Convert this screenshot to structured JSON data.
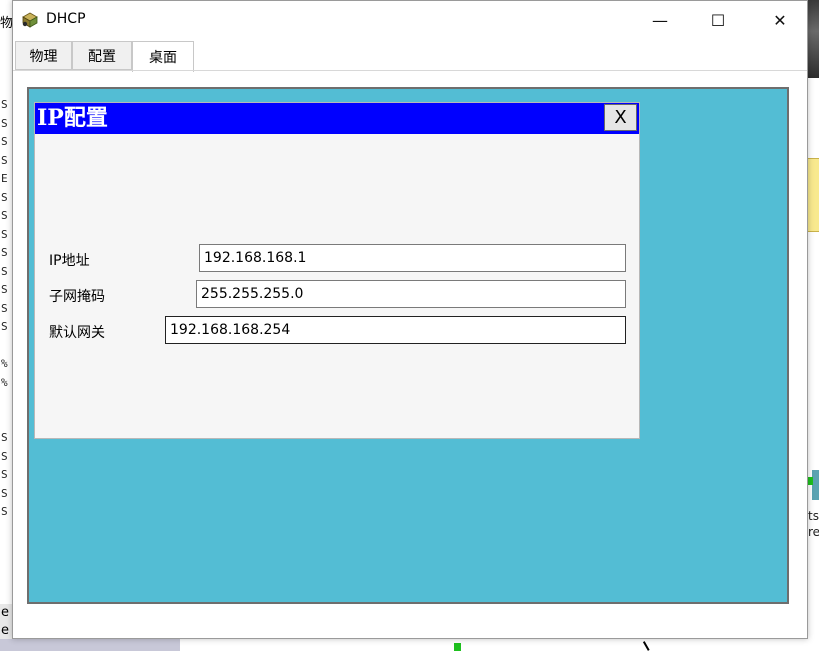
{
  "background": {
    "left_top_char": "物",
    "left_column_letters": [
      "S",
      "S",
      "S",
      "S",
      "E",
      "S",
      "S",
      "S",
      "S",
      "S",
      "S",
      "S",
      "S",
      "",
      "%",
      "%",
      "",
      "",
      "S",
      "S",
      "S",
      "S",
      "S"
    ],
    "bottom_left_letters": [
      "e",
      "e"
    ],
    "right_text": [
      "ts",
      "re"
    ]
  },
  "window": {
    "title": "DHCP",
    "controls": {
      "minimize": "—",
      "maximize": "☐",
      "close": "✕"
    },
    "tabs": [
      {
        "label": "物理"
      },
      {
        "label": "配置"
      },
      {
        "label": "桌面"
      }
    ],
    "active_tab": "桌面"
  },
  "dialog": {
    "title": "IP配置",
    "close_label": "X",
    "fields": {
      "ip_label": "IP地址",
      "ip_value": "192.168.168.1",
      "mask_label": "子网掩码",
      "mask_value": "255.255.255.0",
      "gateway_label": "默认网关",
      "gateway_value": "192.168.168.254"
    }
  },
  "colors": {
    "desktop_bg": "#53bdd4",
    "dialog_title_bg": "#0000ff"
  }
}
